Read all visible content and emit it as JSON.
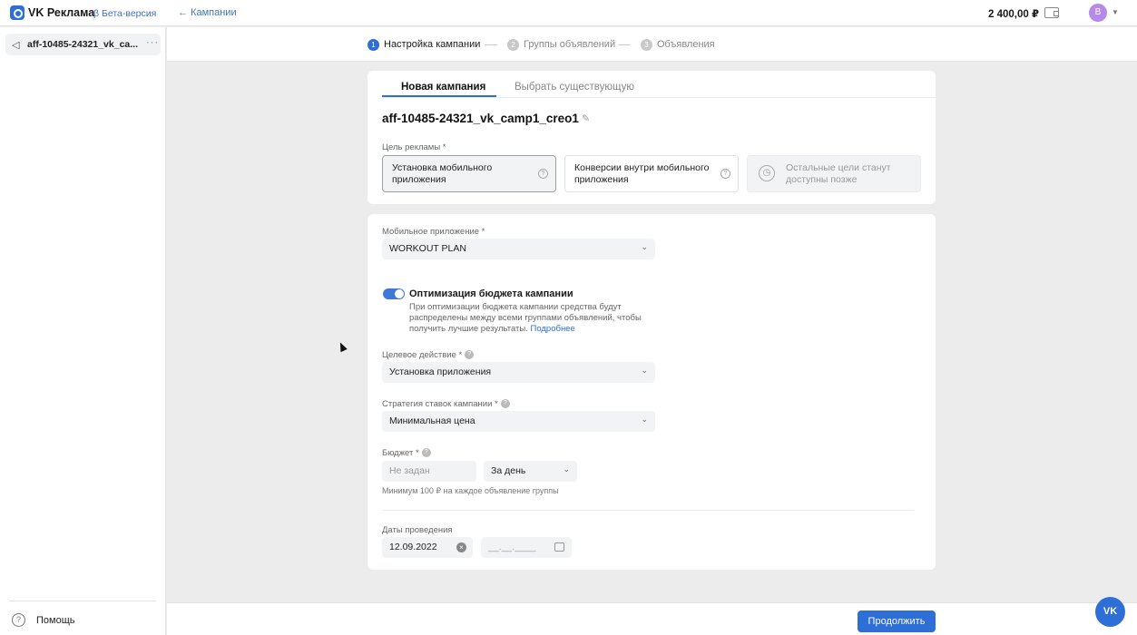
{
  "header": {
    "brand": "VK Реклама",
    "beta": "β Бета-версия",
    "back_link": "← Кампании",
    "balance": "2 400,00 ₽",
    "avatar_letter": "В"
  },
  "sidebar": {
    "item_label": "aff-10485-24321_vk_ca...",
    "help": "Помощь"
  },
  "steps": [
    {
      "num": "1",
      "label": "Настройка кампании"
    },
    {
      "num": "2",
      "label": "Группы объявлений"
    },
    {
      "num": "3",
      "label": "Объявления"
    }
  ],
  "tabs": [
    "Новая кампания",
    "Выбрать существующую"
  ],
  "campaign_name": "aff-10485-24321_vk_camp1_creo1",
  "goal": {
    "label": "Цель рекламы *",
    "options": [
      "Установка мобильного приложения",
      "Конверсии внутри мобильного приложения",
      "Остальные цели станут доступны позже"
    ]
  },
  "app": {
    "label": "Мобильное приложение *",
    "value": "WORKOUT PLAN"
  },
  "budget_opt": {
    "title": "Оптимизация бюджета кампании",
    "desc": "При оптимизации бюджета кампании средства будут распределены между всеми группами объявлений, чтобы получить лучшие результаты.",
    "link": "Подробнее"
  },
  "target_action": {
    "label": "Целевое действие *",
    "value": "Установка приложения"
  },
  "strategy": {
    "label": "Стратегия ставок кампании *",
    "value": "Минимальная цена"
  },
  "budget": {
    "label": "Бюджет *",
    "placeholder": "Не задан",
    "period": "За день",
    "hint": "Минимум 100 ₽ на каждое объявление группы"
  },
  "dates": {
    "label": "Даты проведения",
    "start": "12.09.2022",
    "end_placeholder": "__.__.____"
  },
  "footer": {
    "continue": "Продолжить",
    "fab": "VK"
  }
}
